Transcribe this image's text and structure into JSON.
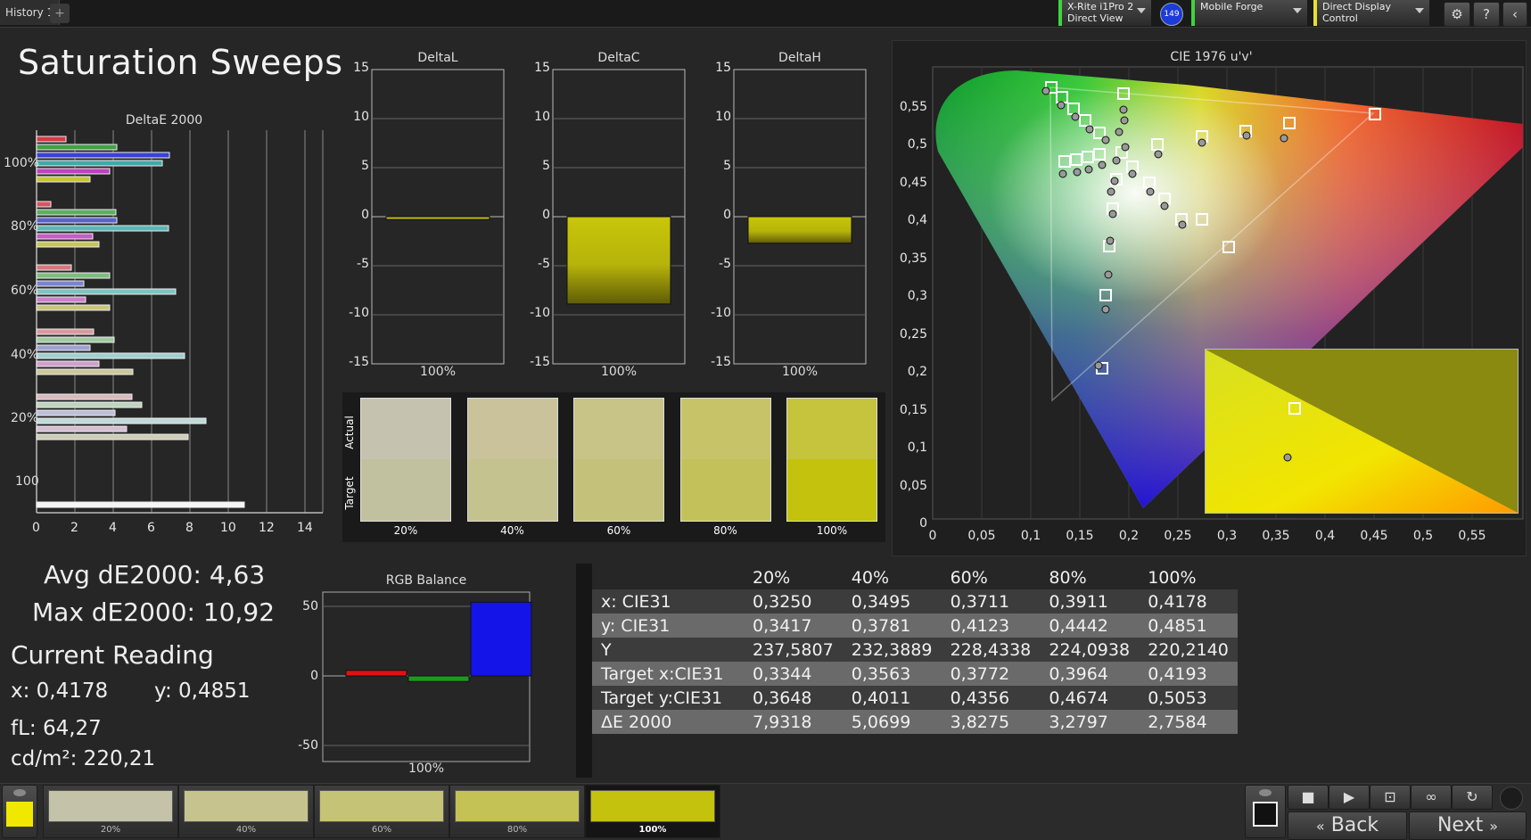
{
  "topbar": {
    "tab_label": "History 1",
    "tab_add": "+",
    "meter_line1": "X-Rite i1Pro 2",
    "meter_line2": "Direct View",
    "badge": "149",
    "generator": "Mobile Forge",
    "display_control": "Direct Display Control",
    "settings_glyph": "⚙",
    "help_glyph": "?",
    "back_glyph": "‹"
  },
  "page": {
    "title": "Saturation Sweeps"
  },
  "de2000_chart": {
    "title": "DeltaE 2000",
    "xticks": [
      "0",
      "2",
      "4",
      "6",
      "8",
      "10",
      "12",
      "14"
    ],
    "group_labels": [
      "100%",
      "80%",
      "60%",
      "40%",
      "20%",
      "100"
    ]
  },
  "delta_charts": {
    "ticks": [
      "15",
      "10",
      "5",
      "0",
      "-5",
      "-10",
      "-15"
    ],
    "charts": [
      {
        "title": "DeltaL",
        "value": -0.3,
        "label": "100%"
      },
      {
        "title": "DeltaC",
        "value": -8.9,
        "label": "100%"
      },
      {
        "title": "DeltaH",
        "value": -2.7,
        "label": "100%"
      }
    ]
  },
  "patches": {
    "actual_label": "Actual",
    "target_label": "Target",
    "items": [
      {
        "label": "20%",
        "actual": "#c5c2af",
        "target": "#c2c19f"
      },
      {
        "label": "40%",
        "actual": "#c9c29a",
        "target": "#c4c28f"
      },
      {
        "label": "60%",
        "actual": "#c8c386",
        "target": "#c4c27a"
      },
      {
        "label": "80%",
        "actual": "#c7c368",
        "target": "#c3c25a"
      },
      {
        "label": "100%",
        "actual": "#c6c33c",
        "target": "#c4c20c"
      }
    ]
  },
  "cie": {
    "title": "CIE 1976 u'v'",
    "xticks": [
      "0",
      "0,05",
      "0,1",
      "0,15",
      "0,2",
      "0,25",
      "0,3",
      "0,35",
      "0,4",
      "0,45",
      "0,5",
      "0,55"
    ],
    "yticks": [
      "0",
      "0,05",
      "0,1",
      "0,15",
      "0,2",
      "0,25",
      "0,3",
      "0,35",
      "0,4",
      "0,45",
      "0,5",
      "0,55"
    ]
  },
  "stats": {
    "avg": "Avg dE2000: 4,63",
    "max": "Max dE2000: 10,92",
    "current_reading": "Current Reading",
    "x": "x: 0,4178",
    "y": "y: 0,4851",
    "fl": "fL: 64,27",
    "cdm2": "cd/m²: 220,21"
  },
  "rgb_balance": {
    "title": "RGB Balance",
    "ticks": [
      "50",
      "0",
      "-50"
    ],
    "label": "100%",
    "red": 4,
    "green": -4,
    "blue": 53
  },
  "table": {
    "columns": [
      "",
      "20%",
      "40%",
      "60%",
      "80%",
      "100%"
    ],
    "rows": [
      [
        "x: CIE31",
        "0,3250",
        "0,3495",
        "0,3711",
        "0,3911",
        "0,4178"
      ],
      [
        "y: CIE31",
        "0,3417",
        "0,3781",
        "0,4123",
        "0,4442",
        "0,4851"
      ],
      [
        "Y",
        "237,5807",
        "232,3889",
        "228,4338",
        "224,0938",
        "220,2140"
      ],
      [
        "Target x:CIE31",
        "0,3344",
        "0,3563",
        "0,3772",
        "0,3964",
        "0,4193"
      ],
      [
        "Target y:CIE31",
        "0,3648",
        "0,4011",
        "0,4356",
        "0,4674",
        "0,5053"
      ],
      [
        "ΔE 2000",
        "7,9318",
        "5,0699",
        "3,8275",
        "3,2797",
        "2,7584"
      ]
    ]
  },
  "bottom": {
    "patches": [
      {
        "label": "20%",
        "color": "#c4c2a8"
      },
      {
        "label": "40%",
        "color": "#c6c38f"
      },
      {
        "label": "60%",
        "color": "#c5c375"
      },
      {
        "label": "80%",
        "color": "#c4c254"
      },
      {
        "label": "100%",
        "color": "#c4c20c"
      }
    ],
    "back": "Back",
    "next": "Next"
  }
}
